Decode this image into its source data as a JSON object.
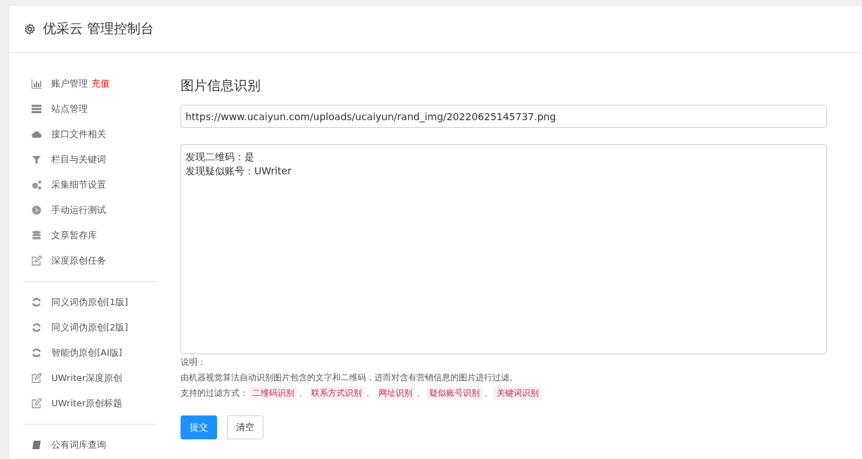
{
  "header": {
    "title": "优采云 管理控制台"
  },
  "sidebar": {
    "groups": [
      {
        "items": [
          {
            "label": "账户管理",
            "badge": "充值"
          },
          {
            "label": "站点管理"
          },
          {
            "label": "接口文件相关"
          },
          {
            "label": "栏目与关键词"
          },
          {
            "label": "采集细节设置"
          },
          {
            "label": "手动运行测试"
          },
          {
            "label": "文章暂存库"
          },
          {
            "label": "深度原创任务"
          }
        ]
      },
      {
        "items": [
          {
            "label": "同义词伪原创[1版]"
          },
          {
            "label": "同义词伪原创[2版]"
          },
          {
            "label": "智能伪原创[AI版]"
          },
          {
            "label": "UWriter深度原创"
          },
          {
            "label": "UWriter原创标题"
          }
        ]
      },
      {
        "items": [
          {
            "label": "公有词库查询"
          }
        ]
      }
    ]
  },
  "main": {
    "title": "图片信息识别",
    "url_field": {
      "value": "https://www.ucaiyun.com/uploads/ucaiyun/rand_img/20220625145737.png"
    },
    "result_box": {
      "lines": [
        "发现二维码：是",
        "发现疑似账号：UWriter"
      ]
    },
    "notes_heading": "说明：",
    "description": "由机器视觉算法自动识别图片包含的文字和二维码，进而对含有营销信息的图片进行过滤。",
    "filters_label": "支持的过滤方式：",
    "separator": "、",
    "filters": [
      "二维码识别",
      "联系方式识别",
      "网址识别",
      "疑似账号识别",
      "关键词识别"
    ],
    "buttons": [
      {
        "label": "提交",
        "kind": "primary"
      },
      {
        "label": "清空",
        "kind": "default"
      }
    ]
  }
}
